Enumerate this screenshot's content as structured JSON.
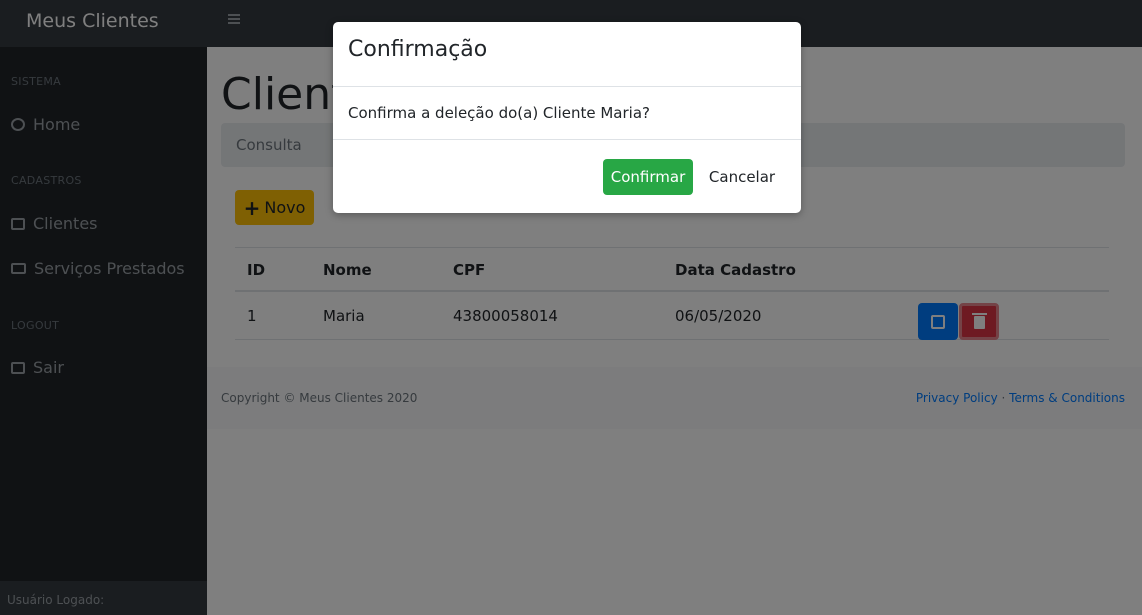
{
  "navbar": {
    "brand": "Meus Clientes"
  },
  "sidebar": {
    "sections": [
      {
        "heading": "SISTEMA",
        "items": [
          {
            "label": "Home",
            "icon": "dashboard-icon"
          }
        ]
      },
      {
        "heading": "CADASTROS",
        "items": [
          {
            "label": "Clientes",
            "icon": "table-icon"
          },
          {
            "label": "Serviços Prestados",
            "icon": "id-card-icon"
          }
        ]
      },
      {
        "heading": "LOGOUT",
        "items": [
          {
            "label": "Sair",
            "icon": "sign-out-icon"
          }
        ]
      }
    ],
    "footer": "Usuário Logado:"
  },
  "main": {
    "title": "Clientes",
    "breadcrumb": "Consulta",
    "new_button": "Novo",
    "table": {
      "headers": [
        "ID",
        "Nome",
        "CPF",
        "Data Cadastro"
      ],
      "rows": [
        [
          "1",
          "Maria",
          "43800058014",
          "06/05/2020"
        ]
      ]
    },
    "footer": {
      "copyright": "Copyright © Meus Clientes 2020",
      "privacy": "Privacy Policy",
      "separator": "·",
      "terms": "Terms & Conditions"
    }
  },
  "modal": {
    "title": "Confirmação",
    "message": "Confirma a deleção do(a) Cliente Maria?",
    "confirm": "Confirmar",
    "cancel": "Cancelar"
  },
  "colors": {
    "navbar": "#343a40",
    "sidebar": "#212529",
    "warning": "#ffc107",
    "primary": "#007bff",
    "danger": "#dc3545",
    "success": "#28a745"
  }
}
